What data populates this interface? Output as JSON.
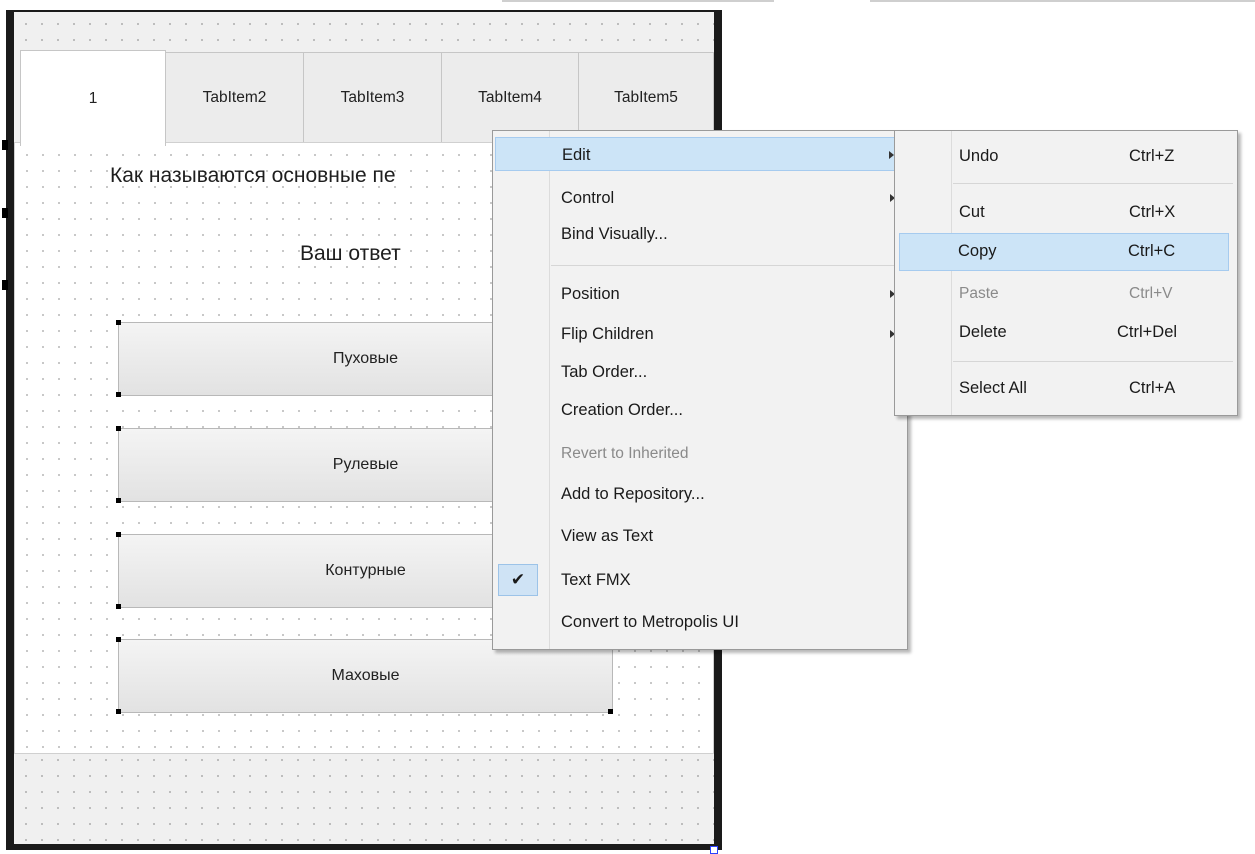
{
  "tabs": [
    "1",
    "TabItem2",
    "TabItem3",
    "TabItem4",
    "TabItem5"
  ],
  "question": "Как называются основные пе",
  "answer_label": "Ваш ответ",
  "options": [
    "Пуховые",
    "Рулевые",
    "Контурные",
    "Маховые"
  ],
  "context_menu": {
    "items": [
      {
        "label": "Edit",
        "submenu": true,
        "highlighted": true
      },
      {
        "label": "Control",
        "submenu": true
      },
      {
        "label": "Bind Visually..."
      },
      {
        "label": "Position",
        "submenu": true
      },
      {
        "label": "Flip Children",
        "submenu": true
      },
      {
        "label": "Tab Order..."
      },
      {
        "label": "Creation Order..."
      },
      {
        "label": "Revert to Inherited",
        "disabled": true
      },
      {
        "label": "Add to Repository..."
      },
      {
        "label": "View as Text"
      },
      {
        "label": "Text FMX",
        "checked": true
      },
      {
        "label": "Convert to Metropolis UI"
      }
    ],
    "check_mark": "✔"
  },
  "edit_submenu": {
    "items": [
      {
        "label": "Undo",
        "shortcut": "Ctrl+Z"
      },
      {
        "label": "Cut",
        "shortcut": "Ctrl+X"
      },
      {
        "label": "Copy",
        "shortcut": "Ctrl+C",
        "highlighted": true
      },
      {
        "label": "Paste",
        "shortcut": "Ctrl+V",
        "disabled": true
      },
      {
        "label": "Delete",
        "shortcut": "Ctrl+Del"
      },
      {
        "label": "Select All",
        "shortcut": "Ctrl+A"
      }
    ]
  },
  "colors": {
    "highlight": "#cce4f7",
    "highlight_border": "#a6cbef",
    "form_frame": "#1a1a1a"
  }
}
